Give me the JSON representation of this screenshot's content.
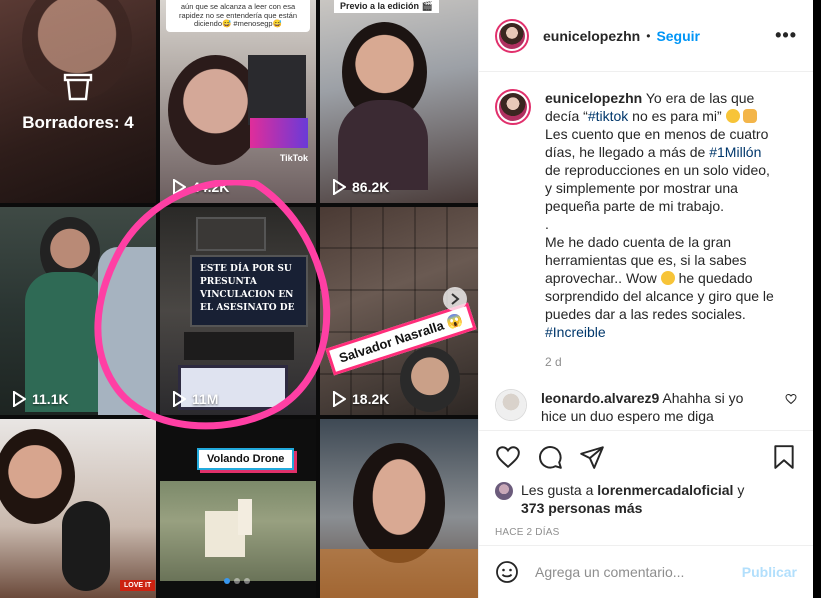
{
  "media": {
    "drafts_label": "Borradores: 4",
    "tile2_caption": "aún que se alcanza a leer con esa rapidez no se entendería que están diciendo😅 #menosegp😅",
    "tile3_caption": "Previo a la edición 🎬",
    "tile5_screen_text": "ESTE DÍA POR SU PRESUNTA VINCULACION EN EL ASESINATO DE",
    "salvador_badge": "Salvador Nasralla 😱",
    "volando_badge": "Volando Drone",
    "love_it": "LOVE IT",
    "tiktok_mark": "TikTok",
    "plays": {
      "t2": "44.2K",
      "t3": "86.2K",
      "t4": "11.1K",
      "t5": "11M",
      "t6": "18.2K"
    }
  },
  "post": {
    "author": "eunicelopezhn",
    "separator": "•",
    "follow_label": "Seguir",
    "more_label": "•••",
    "caption_author": "eunicelopezhn",
    "caption": {
      "p1": "Yo era de las que decía “",
      "hashtag_tiktok": "#tiktok",
      "p2": " no es para mi” ",
      "p3": " Les cuento que en menos de cuatro días, he llegado a más de ",
      "hashtag_million": "#1Millón",
      "p4": " de reproducciones en un solo video, y simplemente por mostrar una pequeña parte de mi trabajo.",
      "p5": ".",
      "p6": "Me he dado cuenta de la gran herramientas que es, si la sabes aprovechar.. Wow ",
      "p7": " he quedado sorprendido del alcance y giro que le puedes dar a las redes sociales.",
      "hashtag_increible": "#Increible"
    },
    "caption_time": "2 d",
    "comment_author": "leonardo.alvarez9",
    "comment_text": "Ahahha si yo hice un duo",
    "comment_text2": " espero me diga",
    "likes_prefix": "Les gusta a ",
    "likes_user": "lorenmercadaloficial",
    "likes_mid": " y ",
    "likes_count": "373 personas más",
    "posted_ago": "HACE 2 DÍAS",
    "comment_placeholder": "Agrega un comentario...",
    "publish_label": "Publicar"
  },
  "colors": {
    "link": "#00376b",
    "follow": "#0095f6",
    "publish_disabled": "#b2dffc",
    "highlight_ring": "#ff3fa4"
  },
  "icons": [
    "trash-icon",
    "play-icon",
    "chevron-right-icon",
    "heart-icon",
    "comment-icon",
    "share-icon",
    "bookmark-icon",
    "smile-icon",
    "more-icon"
  ]
}
